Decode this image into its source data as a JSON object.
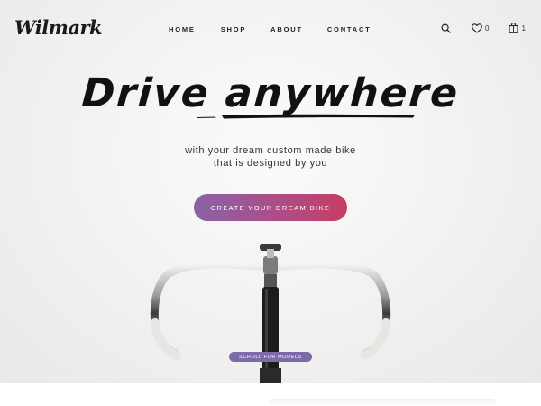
{
  "brand": {
    "logo_text": "Wilmark"
  },
  "nav": {
    "home": "HOME",
    "shop": "SHOP",
    "about": "ABOUT",
    "contact": "CONTACT"
  },
  "header_icons": {
    "search_icon": "search-icon",
    "wishlist_icon": "heart-icon",
    "wishlist_count": "0",
    "cart_icon": "shopping-bag-icon",
    "cart_count": "1"
  },
  "hero": {
    "headline": "Drive anywhere",
    "subtitle_line1": "with your dream custom made bike",
    "subtitle_line2": "that is designed by you",
    "cta_label": "CREATE YOUR DREAM BIKE",
    "scroll_label": "SCROLL FOR MODELS"
  },
  "colors": {
    "cta_gradient_start": "#8a62a6",
    "cta_gradient_end": "#c63d63",
    "scroll_badge": "#7d6aa8",
    "text": "#111111"
  }
}
